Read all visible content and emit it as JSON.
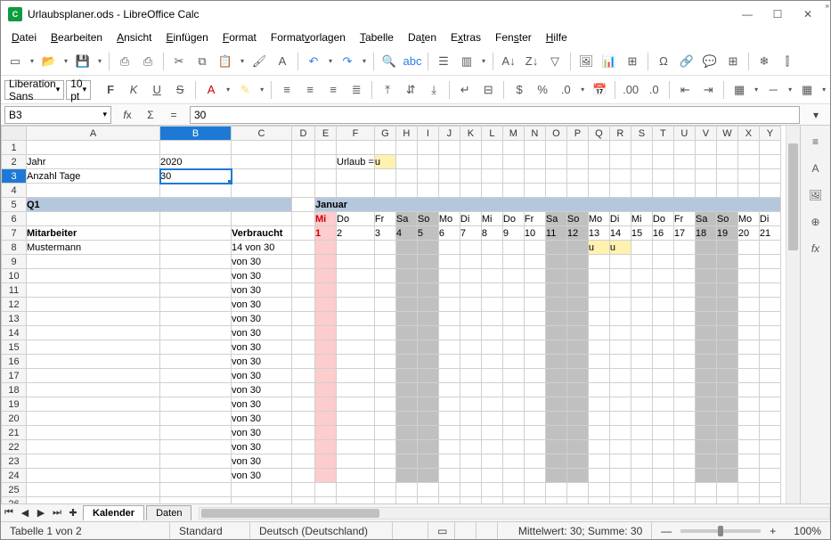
{
  "window": {
    "title": "Urlaubsplaner.ods - LibreOffice Calc",
    "appicon_text": "C"
  },
  "menu": {
    "items": [
      "Datei",
      "Bearbeiten",
      "Ansicht",
      "Einfügen",
      "Format",
      "Formatvorlagen",
      "Tabelle",
      "Daten",
      "Extras",
      "Fenster",
      "Hilfe"
    ],
    "ul": [
      0,
      0,
      0,
      0,
      0,
      6,
      0,
      2,
      1,
      3,
      0
    ]
  },
  "font": {
    "name": "Liberation Sans",
    "size": "10 pt"
  },
  "cellref": {
    "name": "B3",
    "formula": "30"
  },
  "sheet": {
    "cols": [
      "A",
      "B",
      "C",
      "D",
      "E",
      "F",
      "G",
      "H",
      "I",
      "J",
      "K",
      "L",
      "M",
      "N",
      "O",
      "P",
      "Q",
      "R",
      "S",
      "T",
      "U",
      "V",
      "W",
      "X",
      "Y"
    ],
    "rows_first": [
      1,
      2,
      3,
      4,
      5,
      6,
      7,
      8,
      9,
      10,
      11,
      12,
      13,
      14,
      15,
      16,
      17,
      18,
      19,
      20,
      21,
      22,
      23,
      24,
      25,
      26
    ],
    "A2": "Jahr",
    "B2": "2020",
    "A3": "Anzahl Tage",
    "B3": "30",
    "F2": "Urlaub =",
    "G2": "u",
    "Q1_title": "Q1",
    "month_title": "Januar",
    "A7": "Mitarbeiter",
    "C7": "Verbraucht",
    "A8": "Mustermann",
    "C8": "14 von 30",
    "von30": "von 30",
    "day_abbr": [
      "Mi",
      "Do",
      "Fr",
      "Sa",
      "So",
      "Mo",
      "Di",
      "Mi",
      "Do",
      "Fr",
      "Sa",
      "So",
      "Mo",
      "Di",
      "Mi",
      "Do",
      "Fr",
      "Sa",
      "So",
      "Mo",
      "Di"
    ],
    "day_num": [
      "1",
      "2",
      "3",
      "4",
      "5",
      "6",
      "7",
      "8",
      "9",
      "10",
      "11",
      "12",
      "13",
      "14",
      "15",
      "16",
      "17",
      "18",
      "19",
      "20",
      "21"
    ],
    "weekend_idx": [
      3,
      4,
      10,
      11,
      17,
      18
    ],
    "holiday_idx": [
      0
    ],
    "R8_u_idx": [
      12,
      13
    ]
  },
  "tabs": {
    "active": "Kalender",
    "inactive": "Daten"
  },
  "status": {
    "sheet": "Tabelle 1 von 2",
    "stylemode": "Standard",
    "lang": "Deutsch (Deutschland)",
    "stats": "Mittelwert: 30; Summe: 30",
    "zoom": "100%"
  },
  "icons": {
    "minimize": "—",
    "maximize": "☐",
    "close": "✕",
    "tb1": [
      "new-icon",
      "open-icon",
      "save-icon",
      "sep",
      "export-pdf-icon",
      "print-icon",
      "sep",
      "cut-icon",
      "copy-icon",
      "paste-icon",
      "clone-format-icon",
      "clear-format-icon",
      "sep",
      "undo-icon",
      "redo-icon",
      "sep",
      "find-icon",
      "spellcheck-icon",
      "sep",
      "row-icon",
      "column-icon",
      "sep",
      "sort-asc-icon",
      "sort-desc-icon",
      "autofilter-icon",
      "sep",
      "image-icon",
      "chart-icon",
      "pivot-icon",
      "sep",
      "special-char-icon",
      "hyperlink-icon",
      "comment-icon",
      "headers-icon",
      "sep",
      "freeze-icon",
      "split-icon"
    ],
    "tb2": [
      "bold-icon",
      "italic-icon",
      "underline-icon",
      "strike-icon",
      "sep",
      "font-color-icon",
      "highlight-icon",
      "sep",
      "align-left-icon",
      "align-center-icon",
      "align-right-icon",
      "justify-icon",
      "sep",
      "align-top-icon",
      "align-middle-icon",
      "align-bottom-icon",
      "sep",
      "wrap-icon",
      "merge-icon",
      "sep",
      "currency-icon",
      "percent-icon",
      "number-icon",
      "date-icon",
      "sep",
      "add-decimal-icon",
      "remove-decimal-icon",
      "sep",
      "indent-dec-icon",
      "indent-inc-icon",
      "sep",
      "borders-icon",
      "border-style-icon",
      "border-color-icon",
      "sep",
      "cond-format-icon"
    ],
    "side": [
      "properties-icon",
      "styles-icon",
      "gallery-icon",
      "navigator-icon",
      "functions-icon"
    ]
  }
}
